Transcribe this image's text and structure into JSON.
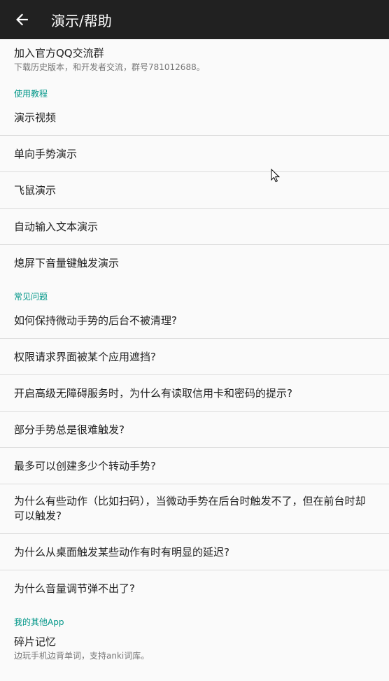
{
  "toolbar": {
    "title": "演示/帮助"
  },
  "group": {
    "title": "加入官方QQ交流群",
    "summary": "下载历史版本，和开发者交流，群号781012688。"
  },
  "tutorial": {
    "header": "使用教程",
    "items": [
      "演示视频",
      "单向手势演示",
      "飞鼠演示",
      "自动输入文本演示",
      "熄屏下音量键触发演示"
    ]
  },
  "faq": {
    "header": "常见问题",
    "items": [
      "如何保持微动手势的后台不被清理?",
      "权限请求界面被某个应用遮挡?",
      "开启高级无障碍服务时，为什么有读取信用卡和密码的提示?",
      "部分手势总是很难触发?",
      "最多可以创建多少个转动手势?",
      "为什么有些动作（比如扫码），当微动手势在后台时触发不了，但在前台时却可以触发?",
      "为什么从桌面触发某些动作有时有明显的延迟?",
      "为什么音量调节弹不出了?"
    ]
  },
  "other_apps": {
    "header": "我的其他App",
    "items": [
      {
        "title": "碎片记忆",
        "summary": "边玩手机边背单词，支持anki词库。"
      }
    ]
  }
}
